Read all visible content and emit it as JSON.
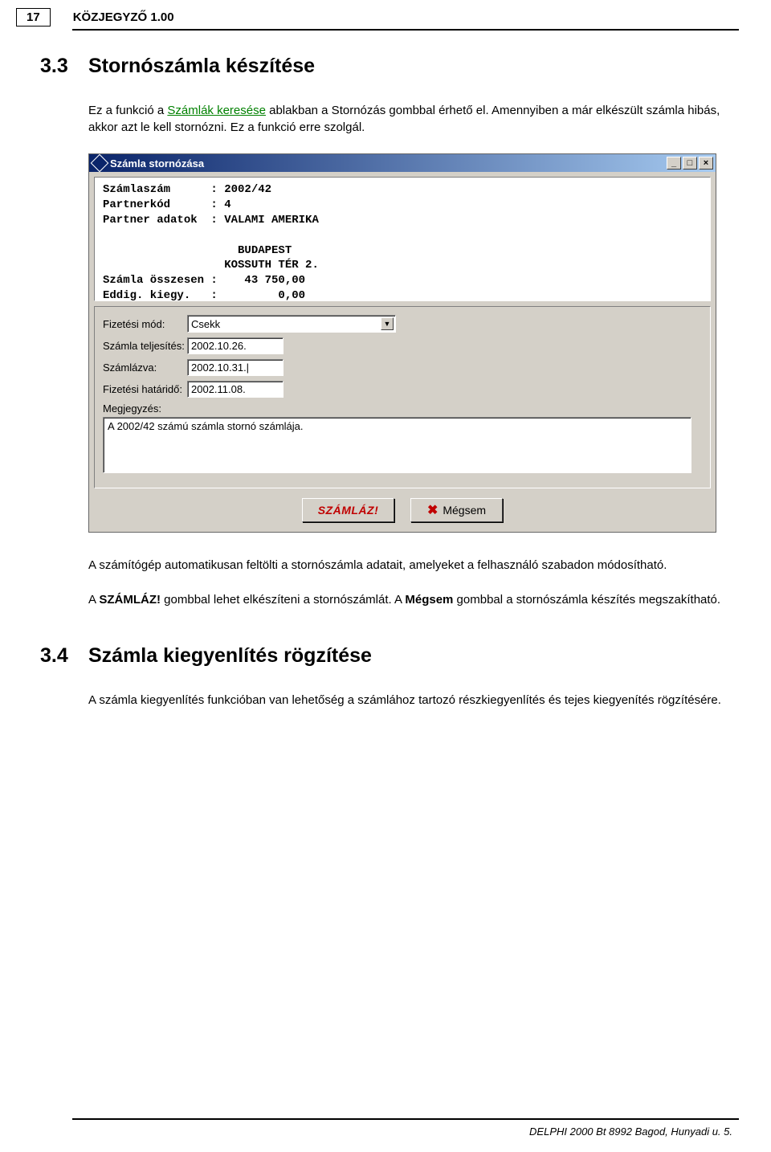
{
  "header": {
    "page_number": "17",
    "doc_title": "KÖZJEGYZŐ 1.00"
  },
  "section33": {
    "number": "3.3",
    "title": "Stornószámla készítése",
    "para1_a": "Ez a funkció a ",
    "para1_link": "Számlák keresése",
    "para1_b": " ablakban a Stornózás gombbal érhető el. Amennyiben a már elkészült számla hibás, akkor azt le kell stornózni. Ez a funkció erre szolgál.",
    "para2_a": "A számítógép automatikusan feltölti a stornószámla adatait, amelyeket a felhasználó szabadon módosítható.",
    "para3_a": "A ",
    "para3_b1": "SZÁMLÁZ!",
    "para3_c": " gombbal lehet elkészíteni a stornószámlát. A ",
    "para3_b2": "Mégsem",
    "para3_d": " gombbal a stornószámla készítés megszakítható."
  },
  "section34": {
    "number": "3.4",
    "title": "Számla kiegyenlítés rögzítése",
    "para1": "A számla kiegyenlítés funkcióban van lehetőség a számlához tartozó részkiegyenlítés és tejes kiegyenítés rögzítésére."
  },
  "window": {
    "title": "Számla stornózása",
    "minimize": "_",
    "maximize": "□",
    "close": "×",
    "info": "Számlaszám      : 2002/42\nPartnerkód      : 4\nPartner adatok  : VALAMI AMERIKA\n\n                    BUDAPEST\n                  KOSSUTH TÉR 2.\nSzámla összesen :    43 750,00\nEddig. kiegy.   :         0,00",
    "labels": {
      "fizmod": "Fizetési mód:",
      "teljesites": "Számla teljesítés:",
      "szamlazva": "Számlázva:",
      "hatarido": "Fizetési határidő:",
      "megjegyzes": "Megjegyzés:"
    },
    "values": {
      "fizmod": "Csekk",
      "teljesites": "2002.10.26.",
      "szamlazva": "2002.10.31.|",
      "hatarido": "2002.11.08.",
      "megjegyzes": "A 2002/42 számú számla stornó számlája."
    },
    "buttons": {
      "szamlaz": "SZÁMLÁZ!",
      "megsem": "Mégsem"
    }
  },
  "footer": "DELPHI 2000 Bt 8992 Bagod, Hunyadi u. 5."
}
